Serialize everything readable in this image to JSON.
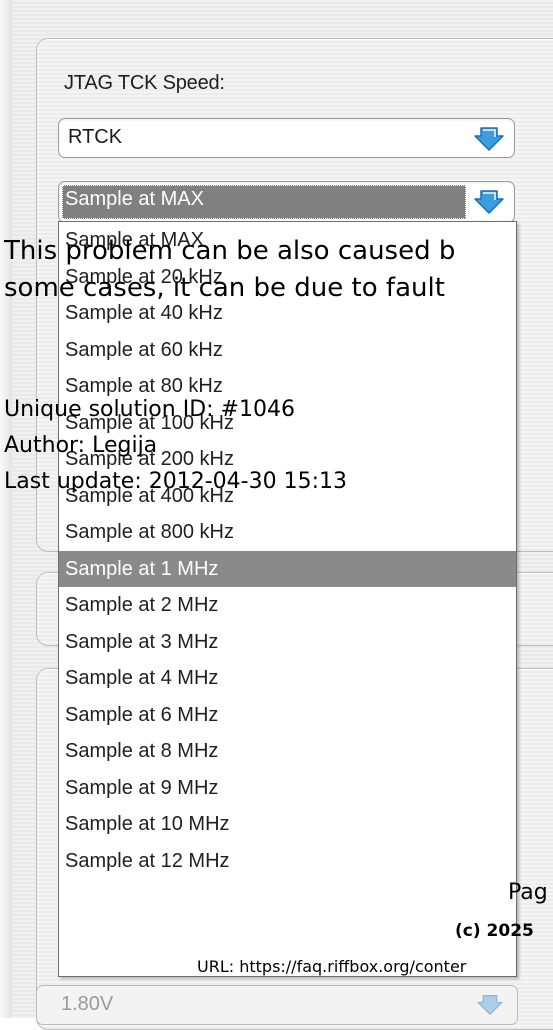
{
  "colors": {
    "panel_bg": "#eeeeee",
    "selected_bg": "#8a8a8a",
    "arrow_blue": "#3a9de0",
    "overlay_text": "#000000"
  },
  "jtag": {
    "label": "JTAG TCK Speed:",
    "speed_value": "RTCK",
    "sample_value": "Sample at MAX"
  },
  "dropdown": {
    "options": [
      "Sample at MAX",
      "Sample at 20 kHz",
      "Sample at 40 kHz",
      "Sample at 60 kHz",
      "Sample at 80 kHz",
      "Sample at 100 kHz",
      "Sample at 200 kHz",
      "Sample at 400 kHz",
      "Sample at 800 kHz",
      "Sample at 1 MHz",
      "Sample at 2 MHz",
      "Sample at 3 MHz",
      "Sample at 4 MHz",
      "Sample at 6 MHz",
      "Sample at 8 MHz",
      "Sample at 9 MHz",
      "Sample at 10 MHz",
      "Sample at 12 MHz"
    ],
    "selected_index": 9
  },
  "voltage": {
    "value": "1.80V"
  },
  "overlay": {
    "line1": "This problem can be also caused b",
    "line2": "some cases, it can be due to fault",
    "solution_id": "Unique solution ID: #1046",
    "author": "Author: Legija",
    "last_update": "Last update: 2012-04-30 15:13",
    "page": "Pag",
    "copyright": "(c) 2025",
    "url": "URL: https://faq.riffbox.org/conter"
  },
  "icons": {
    "combo_arrow": "chevron-down-icon"
  }
}
